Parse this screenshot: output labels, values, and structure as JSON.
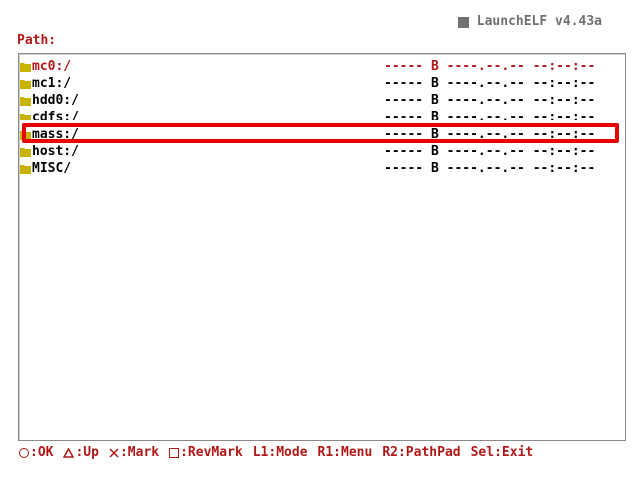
{
  "app": {
    "title": "LaunchELF v4.43a"
  },
  "path": {
    "label": "Path:"
  },
  "files": [
    {
      "name": "mc0:/",
      "info": "----- B ----.--.-- --:--:--",
      "active": true
    },
    {
      "name": "mc1:/",
      "info": "----- B ----.--.-- --:--:--",
      "active": false
    },
    {
      "name": "hdd0:/",
      "info": "----- B ----.--.-- --:--:--",
      "active": false
    },
    {
      "name": "cdfs:/",
      "info": "----- B ----.--.-- --:--:--",
      "active": false
    },
    {
      "name": "mass:/",
      "info": "----- B ----.--.-- --:--:--",
      "active": false
    },
    {
      "name": "host:/",
      "info": "----- B ----.--.-- --:--:--",
      "active": false
    },
    {
      "name": "MISC/",
      "info": "----- B ----.--.-- --:--:--",
      "active": false
    }
  ],
  "footer": {
    "ok": ":OK",
    "up": ":Up",
    "mark": ":Mark",
    "revmark": ":RevMark",
    "mode": "L1:Mode",
    "menu": "R1:Menu",
    "pathpad": "R2:PathPad",
    "exit": "Sel:Exit"
  },
  "colors": {
    "accent": "#b01818",
    "highlight": "#e80000",
    "folder": "#c8b400",
    "title": "#707070"
  }
}
